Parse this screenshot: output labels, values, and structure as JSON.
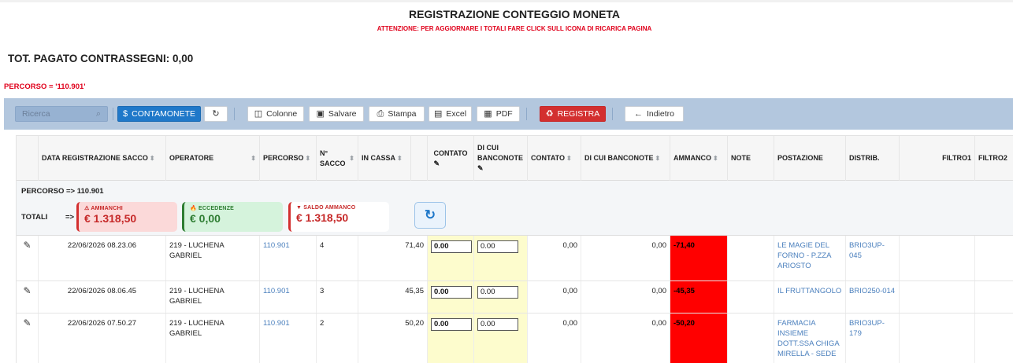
{
  "header": {
    "title": "REGISTRAZIONE CONTEGGIO MONETA",
    "warning": "ATTENZIONE: PER AGGIORNARE I TOTALI FARE CLICK SULL ICONA DI RICARICA PAGINA",
    "tot_pagato": "TOT. PAGATO CONTRASSEGNI: 0,00",
    "filter": "PERCORSO = '110.901'"
  },
  "toolbar": {
    "search_placeholder": "Ricerca",
    "contamonete": "CONTAMONETE",
    "colonne": "Colonne",
    "salvare": "Salvare",
    "stampa": "Stampa",
    "excel": "Excel",
    "pdf": "PDF",
    "registra": "REGISTRA",
    "indietro": "Indietro"
  },
  "columns": {
    "data": "DATA REGISTRAZIONE SACCO",
    "operatore": "OPERATORE",
    "percorso": "PERCORSO",
    "nsacco_1": "N°",
    "nsacco_2": "SACCO",
    "incassa": "IN CASSA",
    "contato_edit": "CONTATO",
    "dicui_edit_1": "DI CUI",
    "dicui_edit_2": "BANCONOTE",
    "contato": "CONTATO",
    "dicui": "DI CUI BANCONOTE",
    "ammanco": "AMMANCO",
    "note": "NOTE",
    "postazione": "POSTAZIONE",
    "distrib": "DISTRIB.",
    "filtro1": "FILTRO1",
    "filtro2": "FILTRO2"
  },
  "group": {
    "label": "PERCORSO => 110.901",
    "totali": "TOTALI",
    "arrow": "=>",
    "ammanchi_label": "⚠ AMMANCHI",
    "ammanchi_value": "€ 1.318,50",
    "eccedenze_label": "🔥 ECCEDENZE",
    "eccedenze_value": "€ 0,00",
    "saldo_label": "▼ SALDO AMMANCO",
    "saldo_value": "€ 1.318,50"
  },
  "rows": [
    {
      "data": "22/06/2026 08.23.06",
      "operatore": "219 - LUCHENA GABRIEL",
      "percorso": "110.901",
      "nsacco": "4",
      "incassa": "71,40",
      "contato_input": "0.00",
      "dicui_input": "0.00",
      "contato": "0,00",
      "dicui": "0,00",
      "ammanco": "-71,40",
      "postazione": "LE MAGIE DEL FORNO - P.ZZA ARIOSTO",
      "distrib": "BRIO3UP-045"
    },
    {
      "data": "22/06/2026 08.06.45",
      "operatore": "219 - LUCHENA GABRIEL",
      "percorso": "110.901",
      "nsacco": "3",
      "incassa": "45,35",
      "contato_input": "0.00",
      "dicui_input": "0.00",
      "contato": "0,00",
      "dicui": "0,00",
      "ammanco": "-45,35",
      "postazione": "IL FRUTTANGOLO",
      "distrib": "BRIO250-014"
    },
    {
      "data": "22/06/2026 07.50.27",
      "operatore": "219 - LUCHENA GABRIEL",
      "percorso": "110.901",
      "nsacco": "2",
      "incassa": "50,20",
      "contato_input": "0.00",
      "dicui_input": "0.00",
      "contato": "0,00",
      "dicui": "0,00",
      "ammanco": "-50,20",
      "postazione": "FARMACIA INSIEME DOTT.SSA CHIGA MIRELLA - SEDE",
      "distrib": "BRIO3UP-179"
    }
  ],
  "colors": {
    "toolbar_bg": "#b3c7de",
    "primary": "#1f78c9",
    "danger": "#d32f2f",
    "ammanco_cell": "#ff0000",
    "contato_cell": "#fdfccd",
    "title_warning": "#e0001b"
  }
}
